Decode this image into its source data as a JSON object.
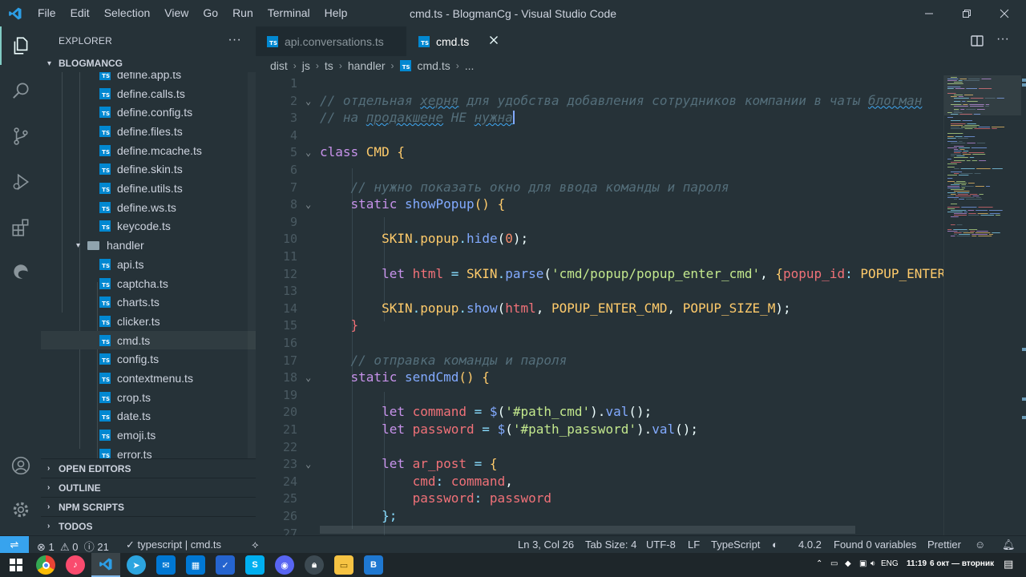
{
  "window": {
    "title": "cmd.ts - BlogmanCg - Visual Studio Code",
    "menu": [
      "File",
      "Edit",
      "Selection",
      "View",
      "Go",
      "Run",
      "Terminal",
      "Help"
    ]
  },
  "sidebar": {
    "header": "EXPLORER",
    "more": "···",
    "project": "BLOGMANCG",
    "files": [
      {
        "name": "define.app.ts",
        "type": "ts"
      },
      {
        "name": "define.calls.ts",
        "type": "ts"
      },
      {
        "name": "define.config.ts",
        "type": "ts"
      },
      {
        "name": "define.files.ts",
        "type": "ts"
      },
      {
        "name": "define.mcache.ts",
        "type": "ts"
      },
      {
        "name": "define.skin.ts",
        "type": "ts"
      },
      {
        "name": "define.utils.ts",
        "type": "ts"
      },
      {
        "name": "define.ws.ts",
        "type": "ts"
      },
      {
        "name": "keycode.ts",
        "type": "ts"
      },
      {
        "name": "handler",
        "type": "folder"
      },
      {
        "name": "api.ts",
        "type": "ts"
      },
      {
        "name": "captcha.ts",
        "type": "ts"
      },
      {
        "name": "charts.ts",
        "type": "ts"
      },
      {
        "name": "clicker.ts",
        "type": "ts"
      },
      {
        "name": "cmd.ts",
        "type": "ts",
        "selected": true
      },
      {
        "name": "config.ts",
        "type": "ts"
      },
      {
        "name": "contextmenu.ts",
        "type": "ts"
      },
      {
        "name": "crop.ts",
        "type": "ts"
      },
      {
        "name": "date.ts",
        "type": "ts"
      },
      {
        "name": "emoji.ts",
        "type": "ts"
      },
      {
        "name": "error.ts",
        "type": "ts"
      }
    ],
    "sections": [
      "OPEN EDITORS",
      "OUTLINE",
      "NPM SCRIPTS",
      "TODOS"
    ]
  },
  "tabs": [
    {
      "label": "api.conversations.ts",
      "active": false
    },
    {
      "label": "cmd.ts",
      "active": true
    }
  ],
  "breadcrumb": [
    "dist",
    "js",
    "ts",
    "handler",
    "cmd.ts",
    "..."
  ],
  "editor": {
    "line_numbers": [
      "1",
      "2",
      "3",
      "4",
      "5",
      "6",
      "7",
      "8",
      "9",
      "10",
      "11",
      "12",
      "13",
      "14",
      "15",
      "16",
      "17",
      "18",
      "19",
      "20",
      "21",
      "22",
      "23",
      "24",
      "25",
      "26",
      "27"
    ],
    "lines": [
      [],
      [
        {
          "t": "// отдельная ",
          "c": "com"
        },
        {
          "t": "херня",
          "c": "com",
          "sq": true
        },
        {
          "t": " для удобства добавления сотрудников компании в чаты ",
          "c": "com"
        },
        {
          "t": "блогман",
          "c": "com",
          "sq": true
        }
      ],
      [
        {
          "t": "// на ",
          "c": "com"
        },
        {
          "t": "продакшене",
          "c": "com",
          "sq": true
        },
        {
          "t": " НЕ ",
          "c": "com"
        },
        {
          "t": "нужна",
          "c": "com",
          "sq": true
        }
      ],
      [],
      [
        {
          "t": "class ",
          "c": "kw"
        },
        {
          "t": "CMD ",
          "c": "cls"
        },
        {
          "t": "{",
          "c": "cls"
        }
      ],
      [],
      [
        {
          "t": "    // нужно показать окно для ввода команды и пароля",
          "c": "com"
        }
      ],
      [
        {
          "t": "    static ",
          "c": "kw"
        },
        {
          "t": "showPopup",
          "c": "fn"
        },
        {
          "t": "() {",
          "c": "cls"
        }
      ],
      [],
      [
        {
          "t": "        SKIN",
          "c": "cls"
        },
        {
          "t": ".",
          "c": "pun"
        },
        {
          "t": "popup",
          "c": "cls"
        },
        {
          "t": ".",
          "c": "pun"
        },
        {
          "t": "hide",
          "c": "fn"
        },
        {
          "t": "(",
          "c": "plain"
        },
        {
          "t": "0",
          "c": "num"
        },
        {
          "t": ");",
          "c": "plain"
        }
      ],
      [],
      [
        {
          "t": "        let ",
          "c": "kw"
        },
        {
          "t": "html ",
          "c": "var"
        },
        {
          "t": "= ",
          "c": "pun"
        },
        {
          "t": "SKIN",
          "c": "cls"
        },
        {
          "t": ".",
          "c": "pun"
        },
        {
          "t": "parse",
          "c": "fn"
        },
        {
          "t": "(",
          "c": "plain"
        },
        {
          "t": "'cmd/popup/popup_enter_cmd'",
          "c": "str"
        },
        {
          "t": ", ",
          "c": "plain"
        },
        {
          "t": "{",
          "c": "cls"
        },
        {
          "t": "popup_id",
          "c": "var"
        },
        {
          "t": ": ",
          "c": "pun"
        },
        {
          "t": "POPUP_ENTER_CMD",
          "c": "cls"
        }
      ],
      [],
      [
        {
          "t": "        SKIN",
          "c": "cls"
        },
        {
          "t": ".",
          "c": "pun"
        },
        {
          "t": "popup",
          "c": "cls"
        },
        {
          "t": ".",
          "c": "pun"
        },
        {
          "t": "show",
          "c": "fn"
        },
        {
          "t": "(",
          "c": "plain"
        },
        {
          "t": "html",
          "c": "var"
        },
        {
          "t": ", ",
          "c": "plain"
        },
        {
          "t": "POPUP_ENTER_CMD",
          "c": "cls"
        },
        {
          "t": ", ",
          "c": "plain"
        },
        {
          "t": "POPUP_SIZE_M",
          "c": "cls"
        },
        {
          "t": ");",
          "c": "plain"
        }
      ],
      [
        {
          "t": "    }",
          "c": "var"
        }
      ],
      [],
      [
        {
          "t": "    // отправка команды и пароля",
          "c": "com"
        }
      ],
      [
        {
          "t": "    static ",
          "c": "kw"
        },
        {
          "t": "sendCmd",
          "c": "fn"
        },
        {
          "t": "() {",
          "c": "cls"
        }
      ],
      [],
      [
        {
          "t": "        let ",
          "c": "kw"
        },
        {
          "t": "command ",
          "c": "var"
        },
        {
          "t": "= ",
          "c": "pun"
        },
        {
          "t": "$",
          "c": "fn"
        },
        {
          "t": "(",
          "c": "plain"
        },
        {
          "t": "'#path_cmd'",
          "c": "str"
        },
        {
          "t": ").",
          "c": "plain"
        },
        {
          "t": "val",
          "c": "fn"
        },
        {
          "t": "();",
          "c": "plain"
        }
      ],
      [
        {
          "t": "        let ",
          "c": "kw"
        },
        {
          "t": "password ",
          "c": "var"
        },
        {
          "t": "= ",
          "c": "pun"
        },
        {
          "t": "$",
          "c": "fn"
        },
        {
          "t": "(",
          "c": "plain"
        },
        {
          "t": "'#path_password'",
          "c": "str"
        },
        {
          "t": ").",
          "c": "plain"
        },
        {
          "t": "val",
          "c": "fn"
        },
        {
          "t": "();",
          "c": "plain"
        }
      ],
      [],
      [
        {
          "t": "        let ",
          "c": "kw"
        },
        {
          "t": "ar_post ",
          "c": "var"
        },
        {
          "t": "= ",
          "c": "pun"
        },
        {
          "t": "{",
          "c": "cls"
        }
      ],
      [
        {
          "t": "            cmd",
          "c": "var"
        },
        {
          "t": ": ",
          "c": "pun"
        },
        {
          "t": "command",
          "c": "var"
        },
        {
          "t": ",",
          "c": "plain"
        }
      ],
      [
        {
          "t": "            password",
          "c": "var"
        },
        {
          "t": ": ",
          "c": "pun"
        },
        {
          "t": "password",
          "c": "var"
        }
      ],
      [
        {
          "t": "        };",
          "c": "pun"
        }
      ],
      []
    ],
    "fold_lines": [
      "2",
      "5",
      "8",
      "18",
      "23"
    ]
  },
  "status": {
    "problems_errors": "1",
    "problems_warnings": "0",
    "problems_info": "21",
    "language_scope": "typescript | ",
    "file_scope": "cmd.ts",
    "position": "Ln 3, Col 26",
    "tab_size": "Tab Size: 4",
    "encoding": "UTF-8",
    "eol": "LF",
    "language": "TypeScript",
    "ts_version": "4.0.2",
    "variables": "Found 0 variables",
    "formatter": "Prettier"
  },
  "taskbar": {
    "lang": "ENG",
    "time": "11:19",
    "date": "6 окт — вторник"
  },
  "colors": {
    "bg": "#263238",
    "accent": "#80cbc4",
    "remote": "#37a3ee",
    "ts_icon": "#0288d1"
  }
}
